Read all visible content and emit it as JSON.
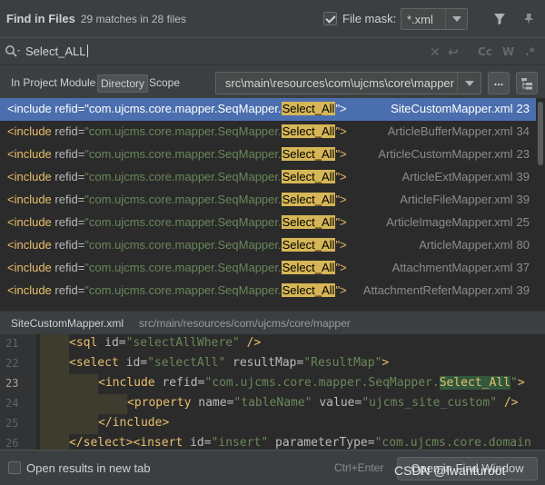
{
  "header": {
    "title": "Find in Files",
    "match_count": "29 matches in 28 files",
    "file_mask_label": "File mask:",
    "file_mask_value": "*.xml",
    "file_mask_checked": true,
    "icons": [
      "filter-icon",
      "pin-icon"
    ]
  },
  "search": {
    "query": "Select_ALL",
    "icons": [
      "search-icon",
      "clear-icon",
      "newline-icon",
      "match-case-icon",
      "words-icon",
      "regex-icon"
    ],
    "labels": {
      "match_case": "Cc",
      "words": "W",
      "regex": ".*"
    }
  },
  "scope": {
    "tabs": [
      {
        "label": "In Project",
        "active": false
      },
      {
        "label": "Module",
        "active": false
      },
      {
        "label": "Directory",
        "active": true
      },
      {
        "label": "Scope",
        "active": false
      }
    ],
    "directory": "src\\main\\resources\\com\\ujcms\\core\\mapper",
    "browse_label": "..."
  },
  "results": [
    {
      "prefix": "<include ",
      "attr": "refid",
      "eq": "=",
      "value": "\"com.ujcms.core.mapper.SeqMapper.",
      "match": "Select_All",
      "suffix": "\">",
      "file": "SiteCustomMapper.xml",
      "line": "23",
      "selected": true
    },
    {
      "prefix": "<include ",
      "attr": "refid",
      "eq": "=",
      "value": "\"com.ujcms.core.mapper.SeqMapper.",
      "match": "Select_All",
      "suffix": "\">",
      "file": "ArticleBufferMapper.xml",
      "line": "34",
      "selected": false
    },
    {
      "prefix": "<include ",
      "attr": "refid",
      "eq": "=",
      "value": "\"com.ujcms.core.mapper.SeqMapper.",
      "match": "Select_All",
      "suffix": "\">",
      "file": "ArticleCustomMapper.xml",
      "line": "23",
      "selected": false
    },
    {
      "prefix": "<include ",
      "attr": "refid",
      "eq": "=",
      "value": "\"com.ujcms.core.mapper.SeqMapper.",
      "match": "Select_All",
      "suffix": "\">",
      "file": "ArticleExtMapper.xml",
      "line": "39",
      "selected": false
    },
    {
      "prefix": "<include ",
      "attr": "refid",
      "eq": "=",
      "value": "\"com.ujcms.core.mapper.SeqMapper.",
      "match": "Select_All",
      "suffix": "\">",
      "file": "ArticleFileMapper.xml",
      "line": "39",
      "selected": false
    },
    {
      "prefix": "<include ",
      "attr": "refid",
      "eq": "=",
      "value": "\"com.ujcms.core.mapper.SeqMapper.",
      "match": "Select_All",
      "suffix": "\">",
      "file": "ArticleImageMapper.xml",
      "line": "25",
      "selected": false
    },
    {
      "prefix": "<include ",
      "attr": "refid",
      "eq": "=",
      "value": "\"com.ujcms.core.mapper.SeqMapper.",
      "match": "Select_All",
      "suffix": "\">",
      "file": "ArticleMapper.xml",
      "line": "80",
      "selected": false
    },
    {
      "prefix": "<include ",
      "attr": "refid",
      "eq": "=",
      "value": "\"com.ujcms.core.mapper.SeqMapper.",
      "match": "Select_All",
      "suffix": "\">",
      "file": "AttachmentMapper.xml",
      "line": "37",
      "selected": false
    },
    {
      "prefix": "<include ",
      "attr": "refid",
      "eq": "=",
      "value": "\"com.ujcms.core.mapper.SeqMapper.",
      "match": "Select_All",
      "suffix": "\">",
      "file": "AttachmentReferMapper.xml",
      "line": "39",
      "selected": false
    }
  ],
  "preview": {
    "file": "SiteCustomMapper.xml",
    "path": "src/main/resources/com/ujcms/core/mapper"
  },
  "editor": {
    "current_line": "23",
    "lines": [
      {
        "num": "21",
        "parts": [
          [
            "tag",
            "<sql "
          ],
          [
            "xattr",
            "id="
          ],
          [
            "xval",
            "\"selectAllWhere\""
          ],
          [
            "tag",
            " />"
          ]
        ]
      },
      {
        "num": "22",
        "parts": [
          [
            "tag",
            "<select "
          ],
          [
            "xattr",
            "id="
          ],
          [
            "xval",
            "\"selectAll\""
          ],
          [
            "xattr",
            " resultMap="
          ],
          [
            "xval",
            "\"ResultMap\""
          ],
          [
            "tag",
            ">"
          ]
        ]
      },
      {
        "num": "23",
        "parts": [
          [
            "tag",
            "<include "
          ],
          [
            "xattr",
            "refid="
          ],
          [
            "xval",
            "\"com.ujcms.core.mapper.SeqMapper."
          ],
          [
            "hl",
            "Select_All"
          ],
          [
            "xval",
            "\""
          ],
          [
            "tag",
            ">"
          ]
        ]
      },
      {
        "num": "24",
        "parts": [
          [
            "tag",
            "<property "
          ],
          [
            "xattr",
            "name="
          ],
          [
            "xval",
            "\"tableName\""
          ],
          [
            "xattr",
            " value="
          ],
          [
            "xval",
            "\"ujcms_site_custom\""
          ],
          [
            "tag",
            " />"
          ]
        ]
      },
      {
        "num": "25",
        "parts": [
          [
            "tag",
            "</include>"
          ]
        ]
      },
      {
        "num": "26",
        "parts": [
          [
            "tag",
            "</select><insert "
          ],
          [
            "xattr",
            "id="
          ],
          [
            "xval",
            "\"insert\""
          ],
          [
            "xattr",
            " parameterType="
          ],
          [
            "xval",
            "\"com.ujcms.core.domain"
          ]
        ]
      }
    ]
  },
  "footer": {
    "open_results_label": "Open results in new tab",
    "shortcut": "Ctrl+Enter",
    "button_label": "Open in Find Window"
  },
  "watermark": "CSDN @lwanturoot",
  "colors": {
    "selection": "#4b6eaf",
    "match_highlight": "#d6b656",
    "tag": "#e8bf6a",
    "string": "#6a8759"
  }
}
